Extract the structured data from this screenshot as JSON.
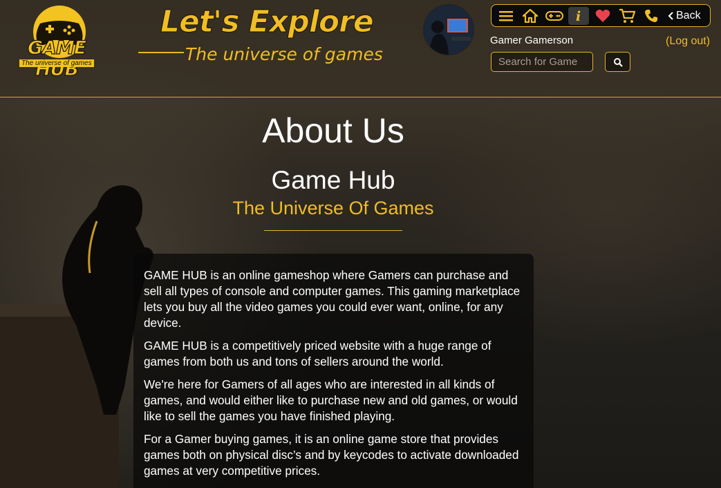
{
  "brand": {
    "logo_title": "GAME HUB",
    "logo_tagline": "The universe of games",
    "accent_color": "#f0bd25"
  },
  "hero": {
    "title": "Let's Explore",
    "subtitle": "The universe of games"
  },
  "nav": {
    "icons": [
      "menu-icon",
      "home-icon",
      "gamepad-icon",
      "info-icon",
      "heart-icon",
      "cart-icon",
      "phone-icon"
    ],
    "back_label": "Back"
  },
  "user": {
    "name": "Gamer Gamerson",
    "logout_label": "(Log out)"
  },
  "search": {
    "placeholder": "Search for Game"
  },
  "main": {
    "title": "About Us",
    "brand_name": "Game Hub",
    "tagline": "The Universe Of Games",
    "paragraphs": [
      "GAME HUB is an online gameshop where Gamers can purchase and sell all types of console and computer games. This gaming marketplace lets you buy all the video games you could ever want, online, for any device.",
      "GAME HUB is a competitively priced website with a huge range of games from both us and tons of sellers around the world.",
      "We're here for Gamers of all ages who are interested in all kinds of games, and would either like to purchase new and old games, or would like to sell the games you have finished playing.",
      "For a Gamer buying games, it is an online game store that provides games both on physical disc’s and by keycodes to activate downloaded games at very competitive prices."
    ]
  }
}
